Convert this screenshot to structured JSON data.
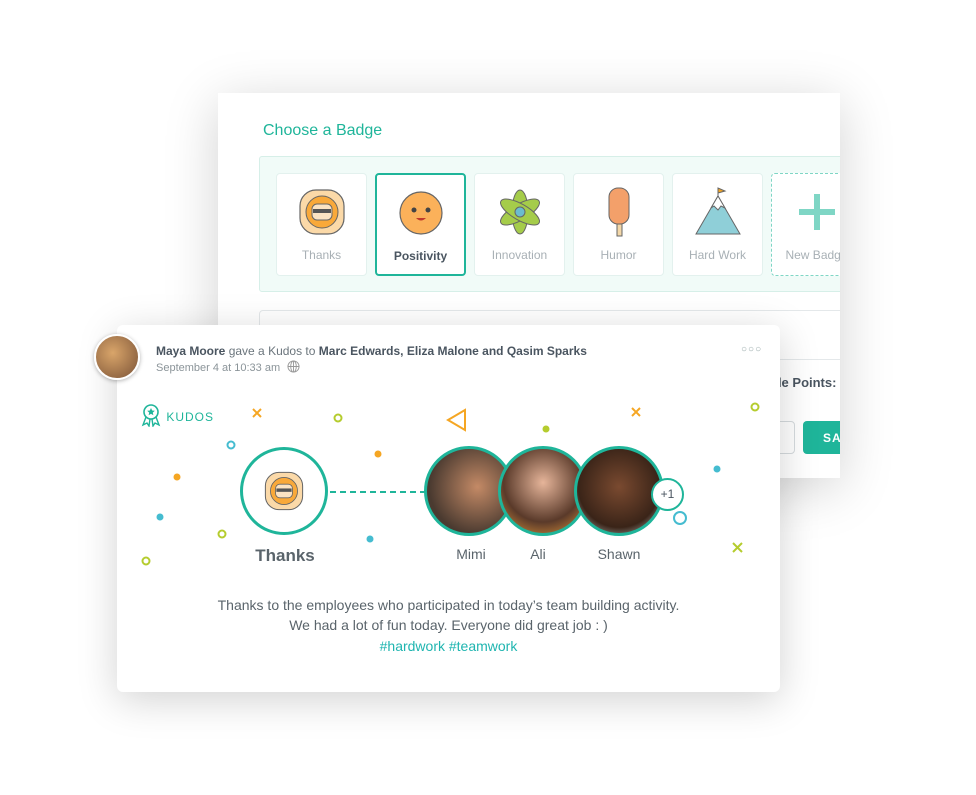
{
  "badge_panel": {
    "title": "Choose a Badge",
    "badges": [
      {
        "label": "Thanks",
        "icon": "sun-face-icon",
        "selected": false
      },
      {
        "label": "Positivity",
        "icon": "smiley-icon",
        "selected": true
      },
      {
        "label": "Innovation",
        "icon": "atom-icon",
        "selected": false
      },
      {
        "label": "Humor",
        "icon": "popsicle-icon",
        "selected": false
      },
      {
        "label": "Hard Work",
        "icon": "mountain-icon",
        "selected": false
      },
      {
        "label": "New Badge",
        "icon": "plus-icon",
        "selected": false
      }
    ],
    "points_label": "ble Points:",
    "save_label": "SAVE"
  },
  "post": {
    "author": "Maya Moore",
    "action": "gave a Kudos to",
    "recipients": "Marc Edwards, Eliza Malone and Qasim Sparks",
    "time": "September 4 at 10:33 am",
    "kudos_label": "KUDOS",
    "badge": "Thanks",
    "people": [
      "Mimi",
      "Ali",
      "Shawn"
    ],
    "more_count": "+1",
    "message_line1": "Thanks to the employees who participated in today’s team building activity.",
    "message_line2": "We had a lot of fun today. Everyone did great job : )",
    "tags": "#hardwork #teamwork"
  },
  "colors": {
    "accent": "#1fb59a",
    "orange": "#f5a623",
    "lime": "#b5cc2e",
    "cyan": "#45bcd0"
  }
}
